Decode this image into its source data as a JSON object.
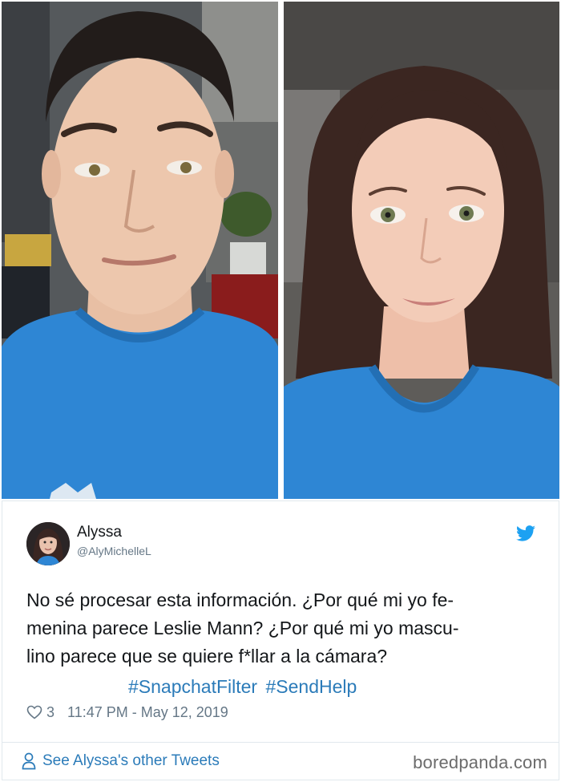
{
  "tweet": {
    "name": "Alyssa",
    "handle": "@AlyMichelleL",
    "text_lines": [
      "No sé procesar esta información. ¿Por qué mi yo fe-",
      "menina parece Leslie Mann? ¿Por qué mi yo mascu-",
      "lino parece que se quiere f*llar a la cámara?"
    ],
    "hashtags": [
      "#SnapchatFilter",
      "#SendHelp"
    ],
    "likes": "3",
    "timestamp": "11:47 PM - May 12, 2019"
  },
  "footer": {
    "see_more": "See Alyssa's other Tweets",
    "watermark": "boredpanda.com"
  },
  "colors": {
    "link": "#2b7bb9",
    "twitter_blue": "#1da1f2",
    "shirt_blue": "#2e86d4",
    "muted": "#657786"
  },
  "icons": [
    "twitter-bird-icon",
    "heart-icon",
    "person-icon"
  ]
}
